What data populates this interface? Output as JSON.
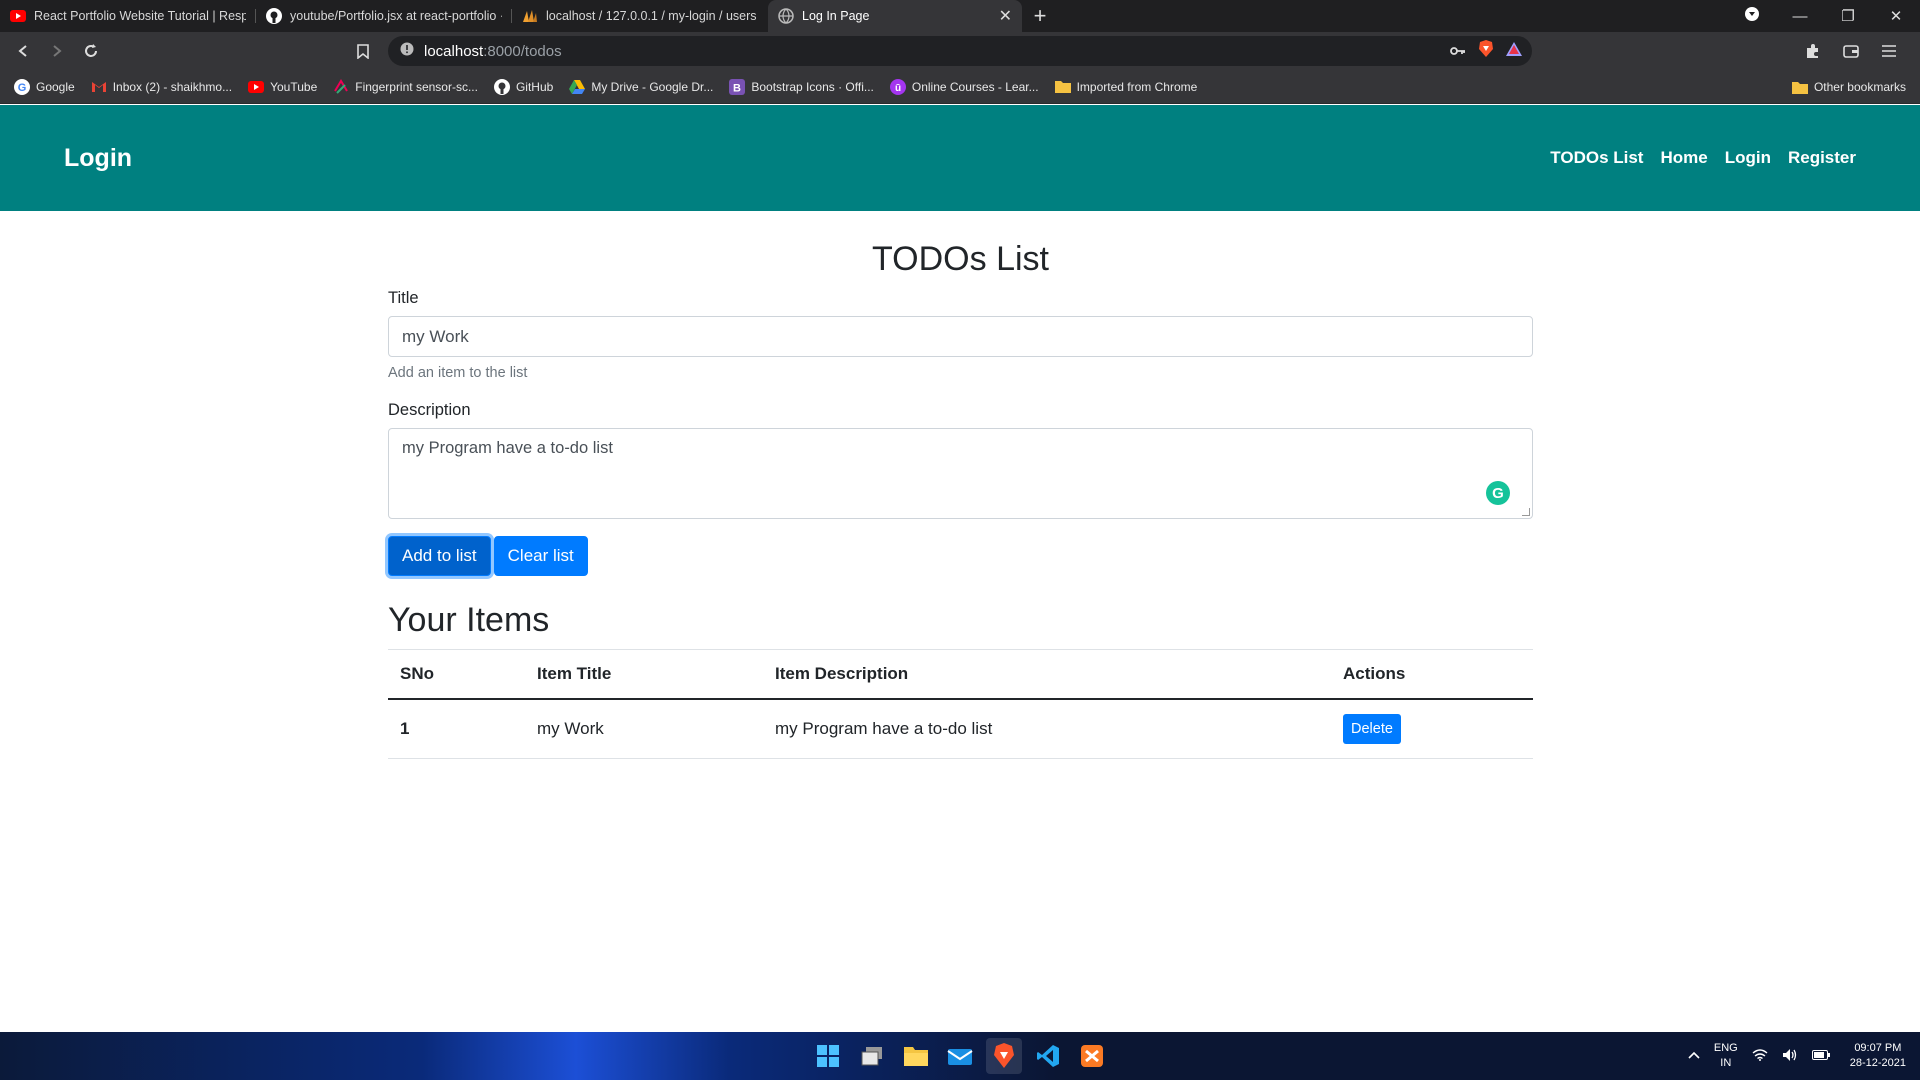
{
  "browser": {
    "tabs": [
      {
        "title": "React Portfolio Website Tutorial | Respons",
        "icon": "youtube-icon",
        "active": false
      },
      {
        "title": "youtube/Portfolio.jsx at react-portfolio · s",
        "icon": "github-icon",
        "active": false
      },
      {
        "title": "localhost / 127.0.0.1 / my-login / users | p",
        "icon": "phpmyadmin-icon",
        "active": false
      },
      {
        "title": "Log In Page",
        "icon": "globe-icon",
        "active": true
      }
    ],
    "address": {
      "host": "localhost",
      "path": ":8000/todos"
    },
    "bookmarks": [
      {
        "label": "Google",
        "icon": "google-icon"
      },
      {
        "label": "Inbox (2) - shaikhmo...",
        "icon": "gmail-icon"
      },
      {
        "label": "YouTube",
        "icon": "youtube-icon"
      },
      {
        "label": "Fingerprint sensor-sc...",
        "icon": "fingerprint-icon"
      },
      {
        "label": "GitHub",
        "icon": "github-icon"
      },
      {
        "label": "My Drive - Google Dr...",
        "icon": "drive-icon"
      },
      {
        "label": "Bootstrap Icons · Offi...",
        "icon": "bootstrap-icon"
      },
      {
        "label": "Online Courses - Lear...",
        "icon": "udemy-icon"
      },
      {
        "label": "Imported from Chrome",
        "icon": "folder-icon"
      }
    ],
    "other_bookmarks": "Other bookmarks"
  },
  "navbar": {
    "brand": "Login",
    "links": [
      "TODOs List",
      "Home",
      "Login",
      "Register"
    ],
    "color": "#008080"
  },
  "form": {
    "heading": "TODOs List",
    "title_label": "Title",
    "title_value": "my Work",
    "title_help": "Add an item to the list",
    "description_label": "Description",
    "description_value": "my Program have a to-do list",
    "add_button": "Add to list",
    "clear_button": "Clear list"
  },
  "items": {
    "heading": "Your Items",
    "columns": [
      "SNo",
      "Item Title",
      "Item Description",
      "Actions"
    ],
    "rows": [
      {
        "sno": "1",
        "title": "my Work",
        "description": "my Program have a to-do list",
        "action": "Delete"
      }
    ]
  },
  "taskbar": {
    "lang_top": "ENG",
    "lang_bottom": "IN",
    "time": "09:07 PM",
    "date": "28-12-2021"
  },
  "colors": {
    "primary": "#007bff",
    "navbar": "#008080"
  }
}
